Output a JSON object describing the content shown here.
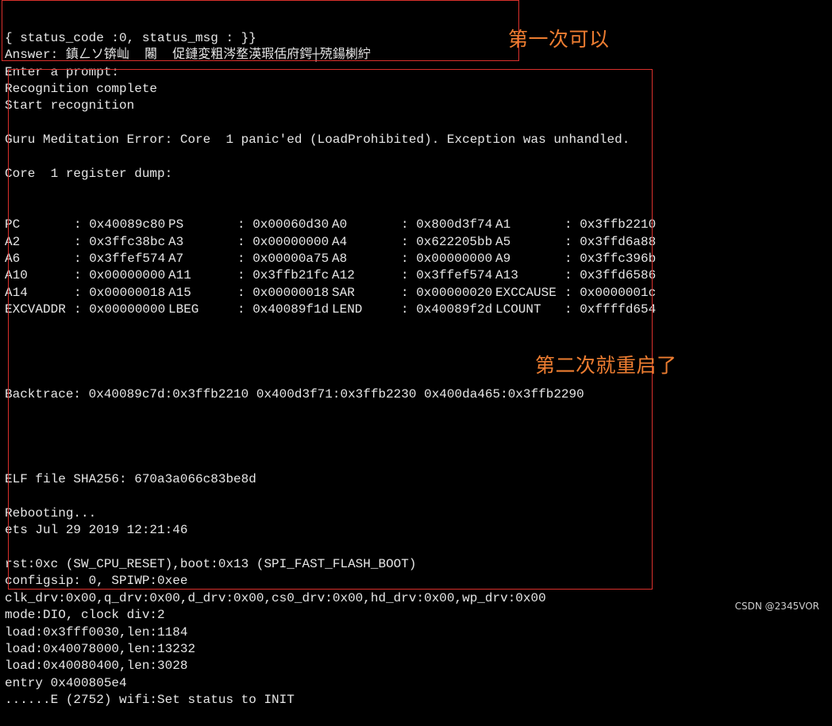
{
  "console": {
    "lines_top": [
      "{ status_code :0, status_msg : }}",
      "Answer: 鎮ㄥソ锛屾  闂  促鏈変粗涔堥渶瑕佸府鍔┼殑鍚楋紵",
      "Enter a prompt:",
      "Recognition complete",
      "Start recognition",
      "",
      "Guru Meditation Error: Core  1 panic'ed (LoadProhibited). Exception was unhandled.",
      "",
      "Core  1 register dump:"
    ],
    "registers": [
      [
        [
          "PC",
          ": 0x40089c80"
        ],
        [
          "PS",
          ": 0x00060d30"
        ],
        [
          "A0",
          ": 0x800d3f74"
        ],
        [
          "A1",
          ": 0x3ffb2210"
        ]
      ],
      [
        [
          "A2",
          ": 0x3ffc38bc"
        ],
        [
          "A3",
          ": 0x00000000"
        ],
        [
          "A4",
          ": 0x622205bb"
        ],
        [
          "A5",
          ": 0x3ffd6a88"
        ]
      ],
      [
        [
          "A6",
          ": 0x3ffef574"
        ],
        [
          "A7",
          ": 0x00000a75"
        ],
        [
          "A8",
          ": 0x00000000"
        ],
        [
          "A9",
          ": 0x3ffc396b"
        ]
      ],
      [
        [
          "A10",
          ": 0x00000000"
        ],
        [
          "A11",
          ": 0x3ffb21fc"
        ],
        [
          "A12",
          ": 0x3ffef574"
        ],
        [
          "A13",
          ": 0x3ffd6586"
        ]
      ],
      [
        [
          "A14",
          ": 0x00000018"
        ],
        [
          "A15",
          ": 0x00000018"
        ],
        [
          "SAR",
          ": 0x00000020"
        ],
        [
          "EXCCAUSE",
          ": 0x0000001c"
        ]
      ],
      [
        [
          "EXCVADDR",
          ": 0x00000000"
        ],
        [
          "LBEG",
          ": 0x40089f1d"
        ],
        [
          "LEND",
          ": 0x40089f2d"
        ],
        [
          "LCOUNT",
          ": 0xffffd654"
        ]
      ]
    ],
    "lines_bottom": [
      "",
      "",
      "Backtrace: 0x40089c7d:0x3ffb2210 0x400d3f71:0x3ffb2230 0x400da465:0x3ffb2290",
      "",
      "",
      "",
      "",
      "ELF file SHA256: 670a3a066c83be8d",
      "",
      "Rebooting...",
      "ets Jul 29 2019 12:21:46",
      "",
      "rst:0xc (SW_CPU_RESET),boot:0x13 (SPI_FAST_FLASH_BOOT)",
      "configsip: 0, SPIWP:0xee",
      "clk_drv:0x00,q_drv:0x00,d_drv:0x00,cs0_drv:0x00,hd_drv:0x00,wp_drv:0x00",
      "mode:DIO, clock div:2",
      "load:0x3fff0030,len:1184",
      "load:0x40078000,len:13232",
      "load:0x40080400,len:3028",
      "entry 0x400805e4",
      "......E (2752) wifi:Set status to INIT"
    ]
  },
  "annotations": {
    "first": "第一次可以",
    "second": "第二次就重启了"
  },
  "watermark": "CSDN @2345VOR",
  "colors": {
    "background": "#000000",
    "text": "#e6e6e6",
    "box": "#d9302c",
    "note": "#ed7d31"
  }
}
